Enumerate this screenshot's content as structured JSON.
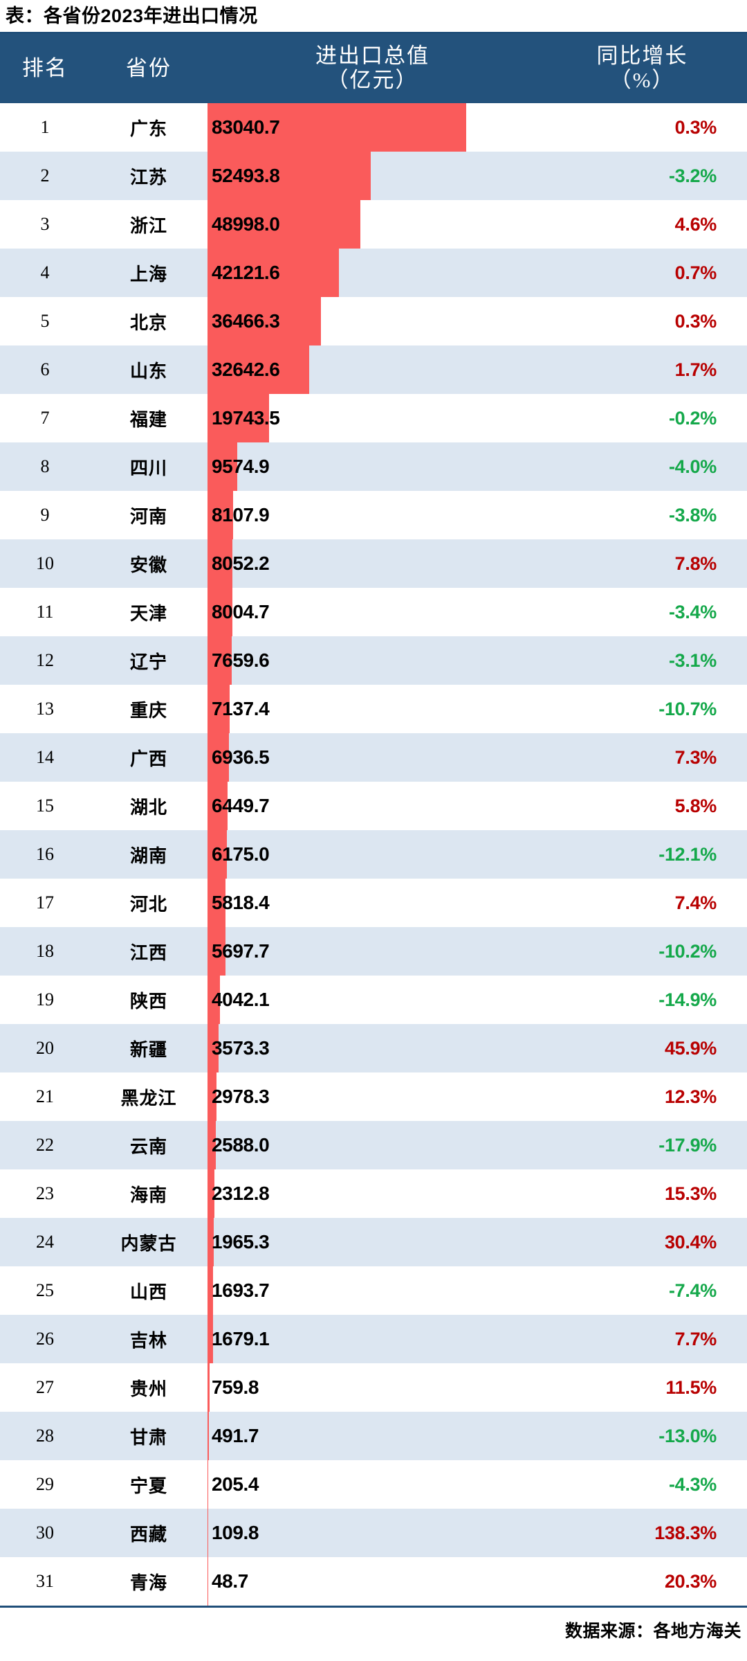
{
  "title": "表：各省份2023年进出口情况",
  "colors": {
    "header_bg": "#23527C",
    "header_text": "#FFFFFF",
    "row_alt_bg": "#DCE6F1",
    "bar": "#FA5B5B",
    "positive": "#B80000",
    "negative": "#14A84A",
    "rule": "#1F4E79"
  },
  "columns": [
    {
      "key": "rank",
      "label": "排名",
      "label_line2": ""
    },
    {
      "key": "prov",
      "label": "省份",
      "label_line2": ""
    },
    {
      "key": "value",
      "label": "进出口总值",
      "label_line2": "（亿元）"
    },
    {
      "key": "yoy",
      "label": "同比增长",
      "label_line2": "（%）"
    }
  ],
  "source": "数据来源：各地方海关",
  "chart_data": {
    "type": "bar",
    "title": "表：各省份2023年进出口情况",
    "orientation": "horizontal",
    "xlabel": "进出口总值（亿元）",
    "ylabel": "省份",
    "grid": false,
    "legend": "none",
    "value_axis_max": 83040.7,
    "categories": [
      "广东",
      "江苏",
      "浙江",
      "上海",
      "北京",
      "山东",
      "福建",
      "四川",
      "河南",
      "安徽",
      "天津",
      "辽宁",
      "重庆",
      "广西",
      "湖北",
      "湖南",
      "河北",
      "江西",
      "陕西",
      "新疆",
      "黑龙江",
      "云南",
      "海南",
      "内蒙古",
      "山西",
      "吉林",
      "贵州",
      "甘肃",
      "宁夏",
      "西藏",
      "青海"
    ],
    "series": [
      {
        "name": "进出口总值（亿元）",
        "values": [
          83040.7,
          52493.8,
          48998.0,
          42121.6,
          36466.3,
          32642.6,
          19743.5,
          9574.9,
          8107.9,
          8052.2,
          8004.7,
          7659.6,
          7137.4,
          6936.5,
          6449.7,
          6175.0,
          5818.4,
          5697.7,
          4042.1,
          3573.3,
          2978.3,
          2588.0,
          2312.8,
          1965.3,
          1693.7,
          1679.1,
          759.8,
          491.7,
          205.4,
          109.8,
          48.7
        ]
      },
      {
        "name": "同比增长（%）",
        "values": [
          0.3,
          -3.2,
          4.6,
          0.7,
          0.3,
          1.7,
          -0.2,
          -4.0,
          -3.8,
          7.8,
          -3.4,
          -3.1,
          -10.7,
          7.3,
          5.8,
          -12.1,
          7.4,
          -10.2,
          -14.9,
          45.9,
          12.3,
          -17.9,
          15.3,
          30.4,
          -7.4,
          7.7,
          11.5,
          -13.0,
          -4.3,
          138.3,
          20.3
        ]
      }
    ]
  },
  "rows": [
    {
      "rank": "1",
      "prov": "广东",
      "value": "83040.7",
      "yoy": "0.3%",
      "v": 83040.7,
      "g": 0.3
    },
    {
      "rank": "2",
      "prov": "江苏",
      "value": "52493.8",
      "yoy": "-3.2%",
      "v": 52493.8,
      "g": -3.2
    },
    {
      "rank": "3",
      "prov": "浙江",
      "value": "48998.0",
      "yoy": "4.6%",
      "v": 48998.0,
      "g": 4.6
    },
    {
      "rank": "4",
      "prov": "上海",
      "value": "42121.6",
      "yoy": "0.7%",
      "v": 42121.6,
      "g": 0.7
    },
    {
      "rank": "5",
      "prov": "北京",
      "value": "36466.3",
      "yoy": "0.3%",
      "v": 36466.3,
      "g": 0.3
    },
    {
      "rank": "6",
      "prov": "山东",
      "value": "32642.6",
      "yoy": "1.7%",
      "v": 32642.6,
      "g": 1.7
    },
    {
      "rank": "7",
      "prov": "福建",
      "value": "19743.5",
      "yoy": "-0.2%",
      "v": 19743.5,
      "g": -0.2
    },
    {
      "rank": "8",
      "prov": "四川",
      "value": "9574.9",
      "yoy": "-4.0%",
      "v": 9574.9,
      "g": -4.0
    },
    {
      "rank": "9",
      "prov": "河南",
      "value": "8107.9",
      "yoy": "-3.8%",
      "v": 8107.9,
      "g": -3.8
    },
    {
      "rank": "10",
      "prov": "安徽",
      "value": "8052.2",
      "yoy": "7.8%",
      "v": 8052.2,
      "g": 7.8
    },
    {
      "rank": "11",
      "prov": "天津",
      "value": "8004.7",
      "yoy": "-3.4%",
      "v": 8004.7,
      "g": -3.4
    },
    {
      "rank": "12",
      "prov": "辽宁",
      "value": "7659.6",
      "yoy": "-3.1%",
      "v": 7659.6,
      "g": -3.1
    },
    {
      "rank": "13",
      "prov": "重庆",
      "value": "7137.4",
      "yoy": "-10.7%",
      "v": 7137.4,
      "g": -10.7
    },
    {
      "rank": "14",
      "prov": "广西",
      "value": "6936.5",
      "yoy": "7.3%",
      "v": 6936.5,
      "g": 7.3
    },
    {
      "rank": "15",
      "prov": "湖北",
      "value": "6449.7",
      "yoy": "5.8%",
      "v": 6449.7,
      "g": 5.8
    },
    {
      "rank": "16",
      "prov": "湖南",
      "value": "6175.0",
      "yoy": "-12.1%",
      "v": 6175.0,
      "g": -12.1
    },
    {
      "rank": "17",
      "prov": "河北",
      "value": "5818.4",
      "yoy": "7.4%",
      "v": 5818.4,
      "g": 7.4
    },
    {
      "rank": "18",
      "prov": "江西",
      "value": "5697.7",
      "yoy": "-10.2%",
      "v": 5697.7,
      "g": -10.2
    },
    {
      "rank": "19",
      "prov": "陕西",
      "value": "4042.1",
      "yoy": "-14.9%",
      "v": 4042.1,
      "g": -14.9
    },
    {
      "rank": "20",
      "prov": "新疆",
      "value": "3573.3",
      "yoy": "45.9%",
      "v": 3573.3,
      "g": 45.9
    },
    {
      "rank": "21",
      "prov": "黑龙江",
      "value": "2978.3",
      "yoy": "12.3%",
      "v": 2978.3,
      "g": 12.3
    },
    {
      "rank": "22",
      "prov": "云南",
      "value": "2588.0",
      "yoy": "-17.9%",
      "v": 2588.0,
      "g": -17.9
    },
    {
      "rank": "23",
      "prov": "海南",
      "value": "2312.8",
      "yoy": "15.3%",
      "v": 2312.8,
      "g": 15.3
    },
    {
      "rank": "24",
      "prov": "内蒙古",
      "value": "1965.3",
      "yoy": "30.4%",
      "v": 1965.3,
      "g": 30.4
    },
    {
      "rank": "25",
      "prov": "山西",
      "value": "1693.7",
      "yoy": "-7.4%",
      "v": 1693.7,
      "g": -7.4
    },
    {
      "rank": "26",
      "prov": "吉林",
      "value": "1679.1",
      "yoy": "7.7%",
      "v": 1679.1,
      "g": 7.7
    },
    {
      "rank": "27",
      "prov": "贵州",
      "value": "759.8",
      "yoy": "11.5%",
      "v": 759.8,
      "g": 11.5
    },
    {
      "rank": "28",
      "prov": "甘肃",
      "value": "491.7",
      "yoy": "-13.0%",
      "v": 491.7,
      "g": -13.0
    },
    {
      "rank": "29",
      "prov": "宁夏",
      "value": "205.4",
      "yoy": "-4.3%",
      "v": 205.4,
      "g": -4.3
    },
    {
      "rank": "30",
      "prov": "西藏",
      "value": "109.8",
      "yoy": "138.3%",
      "v": 109.8,
      "g": 138.3
    },
    {
      "rank": "31",
      "prov": "青海",
      "value": "48.7",
      "yoy": "20.3%",
      "v": 48.7,
      "g": 20.3
    }
  ]
}
